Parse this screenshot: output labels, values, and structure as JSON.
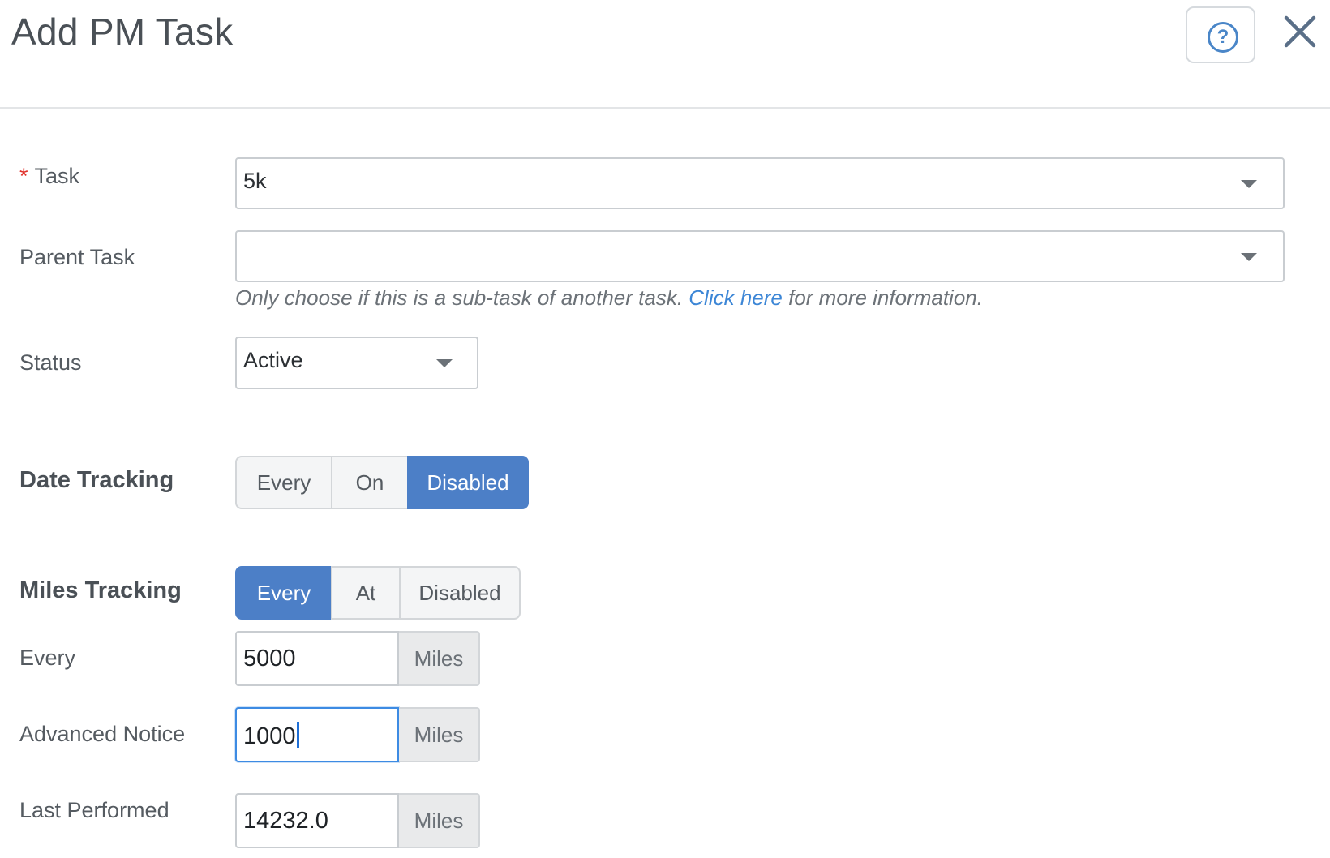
{
  "dialog": {
    "title": "Add PM Task"
  },
  "header": {
    "help_icon": "question-circle-icon",
    "close_icon": "close-x-icon"
  },
  "colors": {
    "accent": "#4c7fc7",
    "required": "#e0312b",
    "link": "#3c86d6",
    "focus": "#3d8be3"
  },
  "form": {
    "task": {
      "required_mark": "*",
      "label": "Task",
      "value": "5k"
    },
    "parent_task": {
      "label": "Parent Task",
      "value": "",
      "hint_before": "Only choose if this is a sub-task of another task.",
      "hint_link": "Click here",
      "hint_after": "for more information."
    },
    "status": {
      "label": "Status",
      "value": "Active"
    },
    "date_tracking": {
      "label": "Date Tracking",
      "options": [
        "Every",
        "On",
        "Disabled"
      ],
      "selected": "Disabled"
    },
    "miles_tracking": {
      "label": "Miles Tracking",
      "options": [
        "Every",
        "At",
        "Disabled"
      ],
      "selected": "Every"
    },
    "every": {
      "label": "Every",
      "value": "5000",
      "unit": "Miles"
    },
    "advanced_notice": {
      "label": "Advanced Notice",
      "value": "1000",
      "unit": "Miles"
    },
    "last_performed": {
      "label": "Last Performed",
      "value": "14232.0",
      "unit": "Miles"
    }
  }
}
